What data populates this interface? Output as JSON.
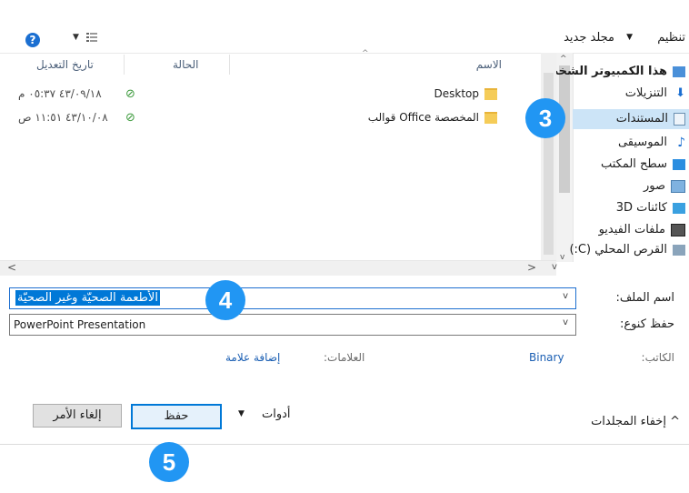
{
  "toolbar": {
    "organize_label": "تنظيم",
    "new_folder_label": "مجلد جديد",
    "help_glyph": "?"
  },
  "nav": {
    "items": [
      {
        "label": "هذا الكمبيوتر الشخصي",
        "icon": "pc-icon"
      },
      {
        "label": "التنزيلات",
        "icon": "download-icon"
      },
      {
        "label": "المستندات",
        "icon": "documents-icon",
        "selected": true
      },
      {
        "label": "الموسيقى",
        "icon": "music-icon"
      },
      {
        "label": "سطح المكتب",
        "icon": "desktop-icon"
      },
      {
        "label": "صور",
        "icon": "pictures-icon"
      },
      {
        "label": "كائنات 3D",
        "icon": "3d-objects-icon"
      },
      {
        "label": "ملفات الفيديو",
        "icon": "videos-icon"
      },
      {
        "label": "القرص المحلي (C:)",
        "icon": "drive-icon"
      }
    ]
  },
  "list": {
    "columns": {
      "name": "الاسم",
      "status": "الحالة",
      "modified": "تاريخ التعديل"
    },
    "rows": [
      {
        "name": "Desktop",
        "status_icon": "synced-check-icon",
        "modified": "٤٣/٠٩/١٨ ٠٥:٣٧ م"
      },
      {
        "name": "المخصصة Office قوالب",
        "status_icon": "synced-check-icon",
        "modified": "٤٣/١٠/٠٨ ١١:٥١ ص"
      }
    ]
  },
  "form": {
    "filename_label": "اسم الملف:",
    "filename_value": "الأطعمة الصحيّة وغير الصحيّة",
    "type_label": "حفظ كنوع:",
    "type_value": "PowerPoint Presentation",
    "author_label": "الكاتب:",
    "author_value": "Binary",
    "tags_label": "العلامات:",
    "tags_value": "إضافة علامة"
  },
  "buttons": {
    "save": "حفظ",
    "cancel": "إلغاء الأمر",
    "tools": "أدوات",
    "hide_folders": "إخفاء المجلدات"
  },
  "callouts": {
    "three": "3",
    "four": "4",
    "five": "5"
  },
  "colors": {
    "accent": "#0078d7",
    "callout": "#2196f3",
    "selection": "#cce4f7"
  }
}
